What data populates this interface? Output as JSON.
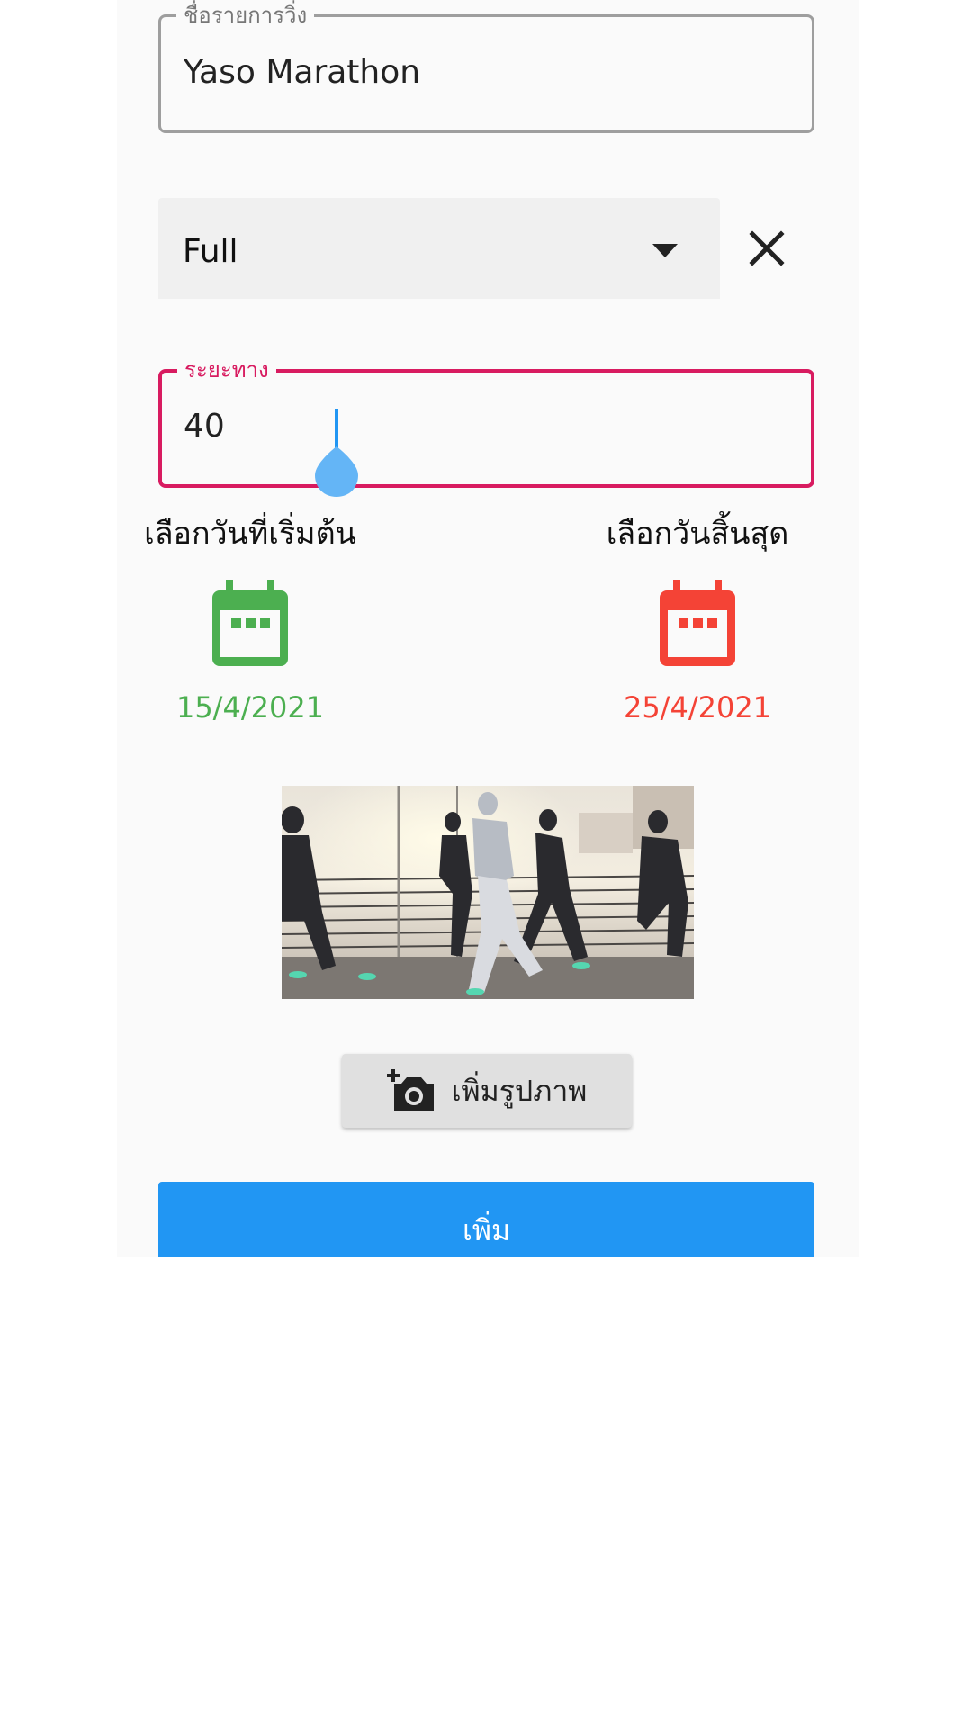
{
  "form": {
    "name_field": {
      "label": "ชื่อรายการวิ่ง",
      "value": "Yaso Marathon"
    },
    "type_dropdown": {
      "selected": "Full"
    },
    "distance_field": {
      "label": "ระยะทาง",
      "value": "40"
    },
    "start_date": {
      "title": "เลือกวันที่เริ่มต้น",
      "value": "15/4/2021",
      "color": "#4caf50"
    },
    "end_date": {
      "title": "เลือกวันสิ้นสุด",
      "value": "25/4/2021",
      "color": "#f44336"
    },
    "add_photo_label": "เพิ่มรูปภาพ",
    "submit_label": "เพิ่ม"
  },
  "colors": {
    "accent": "#d81b60",
    "primary": "#2196f3"
  },
  "icons": {
    "clear": "close-icon",
    "calendar": "calendar-icon",
    "camera": "add-photo-camera-icon"
  }
}
